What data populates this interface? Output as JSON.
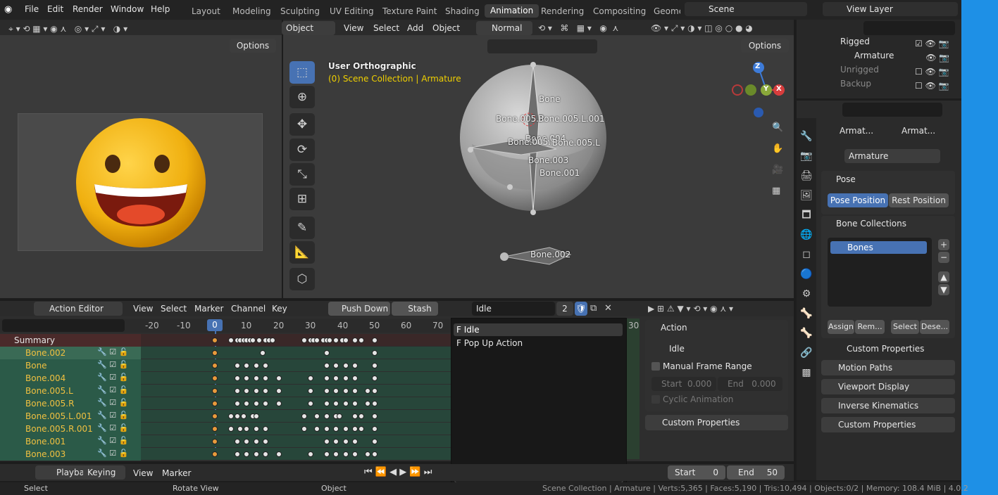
{
  "menu": [
    "File",
    "Edit",
    "Render",
    "Window",
    "Help"
  ],
  "workspaces": [
    "Layout",
    "Modeling",
    "Sculpting",
    "UV Editing",
    "Texture Paint",
    "Shading",
    "Animation",
    "Rendering",
    "Compositing",
    "Geome"
  ],
  "scene": "Scene",
  "view_layer": "View Layer",
  "outliner": {
    "items": [
      "Rigged",
      "Armature",
      "Unrigged",
      "Backup"
    ]
  },
  "left_viewport": {
    "options": "Options"
  },
  "viewport": {
    "mode": "Object Mode",
    "menus": [
      "View",
      "Select",
      "Add",
      "Object"
    ],
    "orientation": "Normal",
    "options": "Options",
    "view_name": "User Orthographic",
    "collection": "(0) Scene Collection | Armature",
    "bones": [
      "Bone",
      "Bone.005.R",
      "Bone.005.L.001",
      "Bone.004",
      "Bone.005.R",
      "Bone.005.L",
      "Bone.003",
      "Bone.001",
      "Bone.002"
    ],
    "gizmo": [
      "Z",
      "Y",
      "X"
    ]
  },
  "properties": {
    "breadcrumb1": "Armat...",
    "breadcrumb2": "Armat...",
    "name": "Armature",
    "pose": "Pose",
    "pose_position": "Pose Position",
    "rest_position": "Rest Position",
    "bone_collections": "Bone Collections",
    "bones_item": "Bones",
    "assign": "Assign",
    "remove": "Rem...",
    "select": "Select",
    "deselect": "Dese...",
    "custom_props1": "Custom Properties",
    "motion_paths": "Motion Paths",
    "viewport_display": "Viewport Display",
    "ik": "Inverse Kinematics",
    "custom_props2": "Custom Properties"
  },
  "action_editor": {
    "mode": "Action Editor",
    "menus": [
      "View",
      "Select",
      "Marker",
      "Channel",
      "Key"
    ],
    "push_down": "Push Down",
    "stash": "Stash",
    "action": "Idle",
    "users": "2",
    "frames": [
      "-20",
      "-10",
      "0",
      "10",
      "20",
      "30",
      "40",
      "50",
      "60",
      "70"
    ],
    "current_frame": "0",
    "right_frame": "30",
    "channels": [
      "Summary",
      "Bone.002",
      "Bone",
      "Bone.004",
      "Bone.005.L",
      "Bone.005.R",
      "Bone.005.L.001",
      "Bone.005.R.001",
      "Bone.001",
      "Bone.003"
    ]
  },
  "dropdown": {
    "items": [
      "F Idle",
      "F Pop Up Action"
    ]
  },
  "action_panel": {
    "title": "Action",
    "name": "Idle",
    "manual_range": "Manual Frame Range",
    "start_label": "Start",
    "start_val": "0.000",
    "end_label": "End",
    "end_val": "0.000",
    "cyclic": "Cyclic Animation",
    "custom_props": "Custom Properties"
  },
  "timeline": {
    "playback": "Playback",
    "keying": "Keying",
    "view": "View",
    "marker": "Marker",
    "start_label": "Start",
    "start": "0",
    "end_label": "End",
    "end": "50"
  },
  "status": {
    "select": "Select",
    "rotate": "Rotate View",
    "object": "Object",
    "info": "Scene Collection | Armature | Verts:5,365 | Faces:5,190 | Tris:10,494 | Objects:0/2 | Memory: 108.4 MiB | 4.0.2"
  }
}
